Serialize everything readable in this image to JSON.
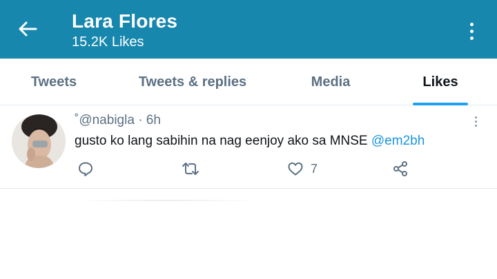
{
  "colors": {
    "brand": "#1787ad",
    "accent": "#1da1f2",
    "mention": "#1b95e0"
  },
  "header": {
    "title": "Lara Flores",
    "subtitle": "15.2K Likes",
    "back_icon": "arrow-left-icon",
    "more_icon": "more-vertical-icon"
  },
  "tabs": [
    {
      "label": "Tweets",
      "active": false
    },
    {
      "label": "Tweets & replies",
      "active": false
    },
    {
      "label": "Media",
      "active": false
    },
    {
      "label": "Likes",
      "active": true
    }
  ],
  "tweet": {
    "handle": "˚@nabigla",
    "separator": "·",
    "time": "6h",
    "text": "gusto ko lang sabihin na nag eenjoy ako sa MNSE",
    "mention": "@em2bh",
    "actions": {
      "reply_icon": "reply-icon",
      "retweet_icon": "retweet-icon",
      "like_icon": "heart-icon",
      "like_count": "7",
      "share_icon": "share-icon"
    }
  }
}
